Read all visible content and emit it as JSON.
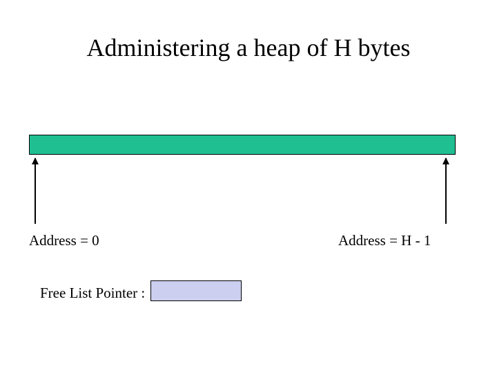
{
  "title": "Administering a heap of H bytes",
  "heap": {
    "label_start": "Address = 0",
    "label_end": "Address = H - 1"
  },
  "free_list": {
    "label": "Free List Pointer :"
  },
  "colors": {
    "heap_fill": "#1fbf92",
    "pointer_box_fill": "#cccff0"
  }
}
